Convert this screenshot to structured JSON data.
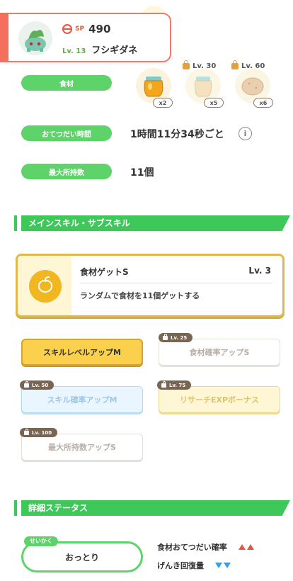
{
  "header": {
    "sp_label": "SP",
    "sp_value": "490",
    "level": "Lv. 13",
    "pokemon_name": "フシギダネ"
  },
  "stats": {
    "ingredients_label": "食材",
    "ingredients": [
      {
        "icon": "honey-icon",
        "locked": false,
        "lock_level": "",
        "quantity": "x2"
      },
      {
        "icon": "jar-icon",
        "locked": true,
        "lock_level": "Lv. 30",
        "quantity": "x5"
      },
      {
        "icon": "potato-icon",
        "locked": true,
        "lock_level": "Lv. 60",
        "quantity": "x6"
      }
    ],
    "help_time_label": "おてつだい時間",
    "help_time_value": "1時間11分34秒ごと",
    "max_carry_label": "最大所持数",
    "max_carry_value": "11個"
  },
  "skills_section": {
    "title": "メインスキル・サブスキル",
    "main_skill": {
      "name": "食材ゲットS",
      "level": "Lv. 3",
      "description": "ランダムで食材を11個ゲットする"
    },
    "sub_skills": [
      {
        "label": "スキルレベルアップM",
        "lock_level": "",
        "style": "active"
      },
      {
        "label": "食材確率アップS",
        "lock_level": "Lv. 25",
        "style": "grey"
      },
      {
        "label": "スキル確率アップM",
        "lock_level": "Lv. 50",
        "style": "blue"
      },
      {
        "label": "リサーチEXPボーナス",
        "lock_level": "Lv. 75",
        "style": "gold"
      },
      {
        "label": "最大所持数アップS",
        "lock_level": "Lv. 100",
        "style": "grey"
      }
    ]
  },
  "detail_section": {
    "title": "詳細ステータス",
    "nature_tag": "せいかく",
    "nature_value": "おっとり",
    "effects": [
      {
        "label": "食材おてつだい確率",
        "direction": "up"
      },
      {
        "label": "げんき回復量",
        "direction": "down"
      }
    ]
  },
  "colors": {
    "accent_green": "#5ed36a",
    "header_red": "#f4705c",
    "skill_gold": "#f2b620",
    "up_red": "#e8553f",
    "down_blue": "#3b9be8"
  }
}
